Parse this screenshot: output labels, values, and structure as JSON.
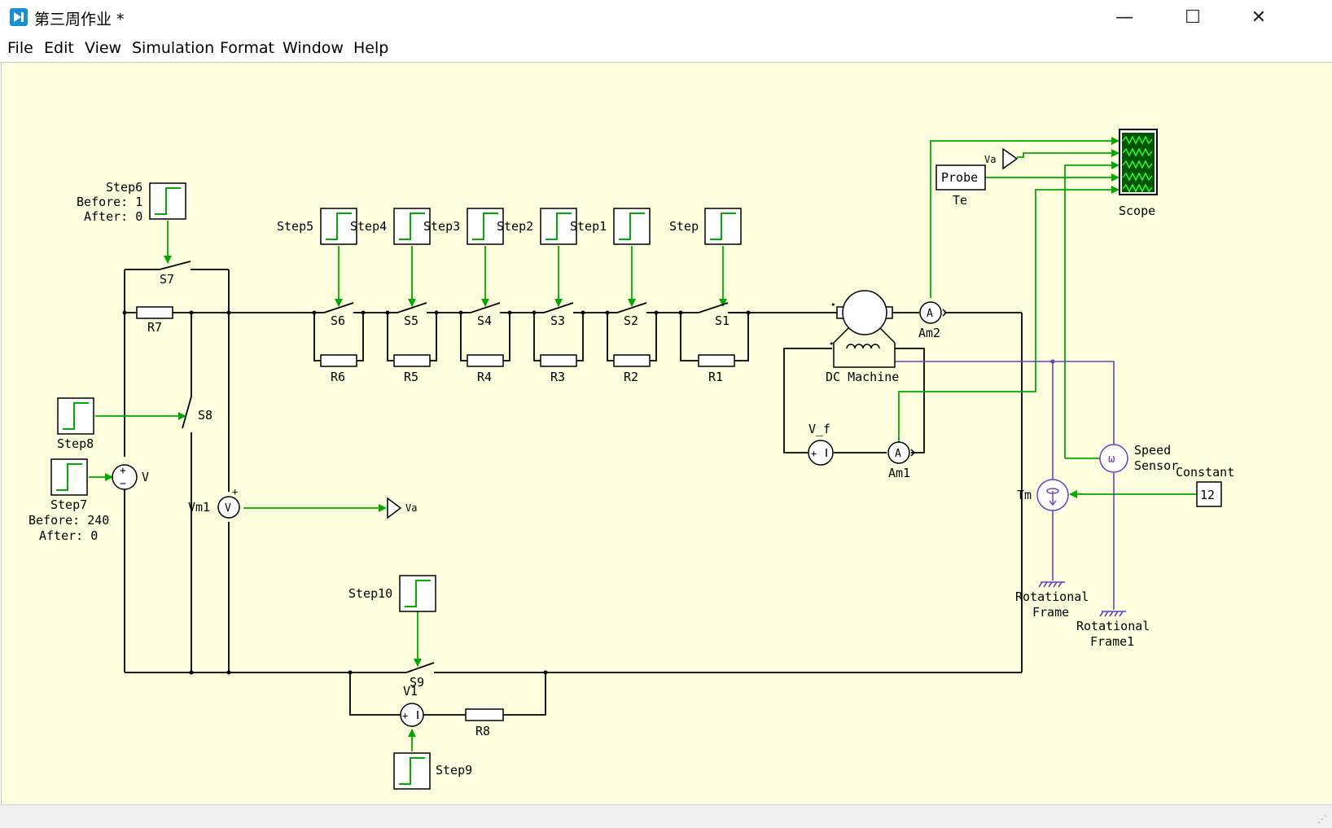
{
  "window": {
    "title": "第三周作业 *",
    "controls": {
      "minimize": "—",
      "maximize": "☐",
      "close": "✕"
    }
  },
  "menu": [
    "File",
    "Edit",
    "View",
    "Simulation",
    "Format",
    "Window",
    "Help"
  ],
  "colors": {
    "canvas": "#ffffe0",
    "wire_electrical": "#000000",
    "wire_signal": "#00aa00",
    "wire_rotational": "#6a3fbf",
    "step_trace": "#00aa00",
    "scope_screen": "#005500"
  },
  "diagram": {
    "steps": {
      "step": "Step",
      "step1": "Step1",
      "step2": "Step2",
      "step3": "Step3",
      "step4": "Step4",
      "step5": "Step5",
      "step6": "Step6",
      "step7": "Step7",
      "step8": "Step8",
      "step9": "Step9",
      "step10": "Step10"
    },
    "step6_params": {
      "before": "Before: 1",
      "after": "After: 0"
    },
    "step7_params": {
      "before": "Before: 240",
      "after": "After: 0"
    },
    "switches": {
      "s1": "S1",
      "s2": "S2",
      "s3": "S3",
      "s4": "S4",
      "s5": "S5",
      "s6": "S6",
      "s7": "S7",
      "s8": "S8",
      "s9": "S9"
    },
    "resistors": {
      "r1": "R1",
      "r2": "R2",
      "r3": "R3",
      "r4": "R4",
      "r5": "R5",
      "r6": "R6",
      "r7": "R7",
      "r8": "R8"
    },
    "sources": {
      "v": "V",
      "v1": "V1",
      "v_f": "V_f",
      "plus": "+",
      "minus": "−"
    },
    "meters": {
      "vm1": "Vm1",
      "am1": "Am1",
      "am2": "Am2",
      "v_symbol": "V",
      "a_symbol": "A"
    },
    "machine": {
      "label": "DC Machine"
    },
    "probe": {
      "label": "Probe",
      "te": "Te"
    },
    "va_output": "Va",
    "va_input": "Va",
    "scope": "Scope",
    "speed_sensor": {
      "line1": "Speed",
      "line2": "Sensor",
      "symbol": "ω"
    },
    "constant": {
      "label": "Constant",
      "value": "12"
    },
    "torque": "Tm",
    "frame": {
      "line1": "Rotational",
      "line2": "Frame"
    },
    "frame1": {
      "line1": "Rotational",
      "line2": "Frame1"
    }
  }
}
